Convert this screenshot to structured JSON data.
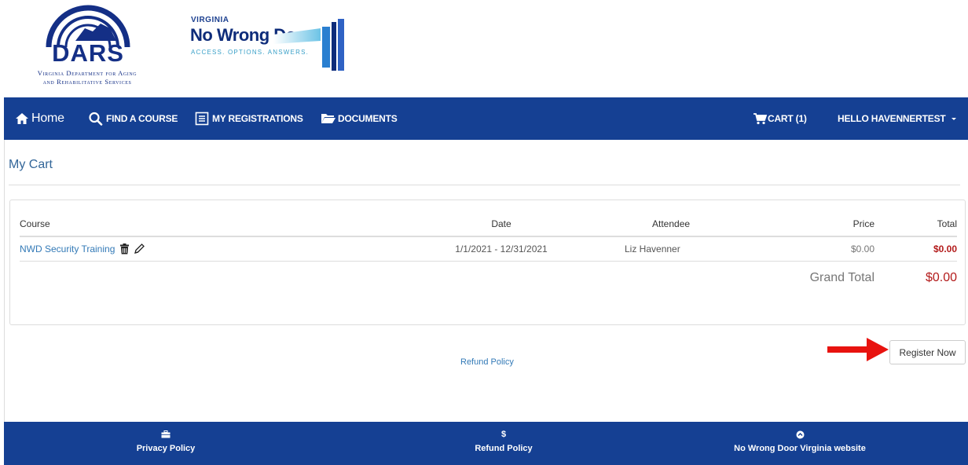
{
  "header": {
    "dars_word": "DARS",
    "dars_sub_line1": "Virginia Department for Aging",
    "dars_sub_line2": "and Rehabilitative Services",
    "nwd_state": "VIRGINIA",
    "nwd_title": "No Wrong Door",
    "nwd_tagline": "ACCESS. OPTIONS. ANSWERS."
  },
  "nav": {
    "home": "Home",
    "find_course": "FIND A COURSE",
    "my_registrations": "MY REGISTRATIONS",
    "documents": "DOCUMENTS",
    "cart": "CART (1)",
    "user": "HELLO HAVENNERTEST"
  },
  "page": {
    "title": "My Cart"
  },
  "cart": {
    "headers": {
      "course": "Course",
      "date": "Date",
      "attendee": "Attendee",
      "price": "Price",
      "total": "Total"
    },
    "rows": [
      {
        "course": "NWD Security Training",
        "date": "1/1/2021 - 12/31/2021",
        "attendee": "Liz Havenner",
        "price": "$0.00",
        "total": "$0.00"
      }
    ],
    "grand_total_label": "Grand Total",
    "grand_total_value": "$0.00"
  },
  "actions": {
    "register_now": "Register Now",
    "refund_policy": "Refund Policy"
  },
  "footer": {
    "privacy": "Privacy Policy",
    "refund_icon": "$",
    "refund": "Refund Policy",
    "nwd_site": "No Wrong Door Virginia website"
  },
  "colors": {
    "brand_blue": "#154093",
    "link_blue": "#337ab7",
    "total_red": "#b31b1b",
    "arrow_red": "#e8130f"
  }
}
